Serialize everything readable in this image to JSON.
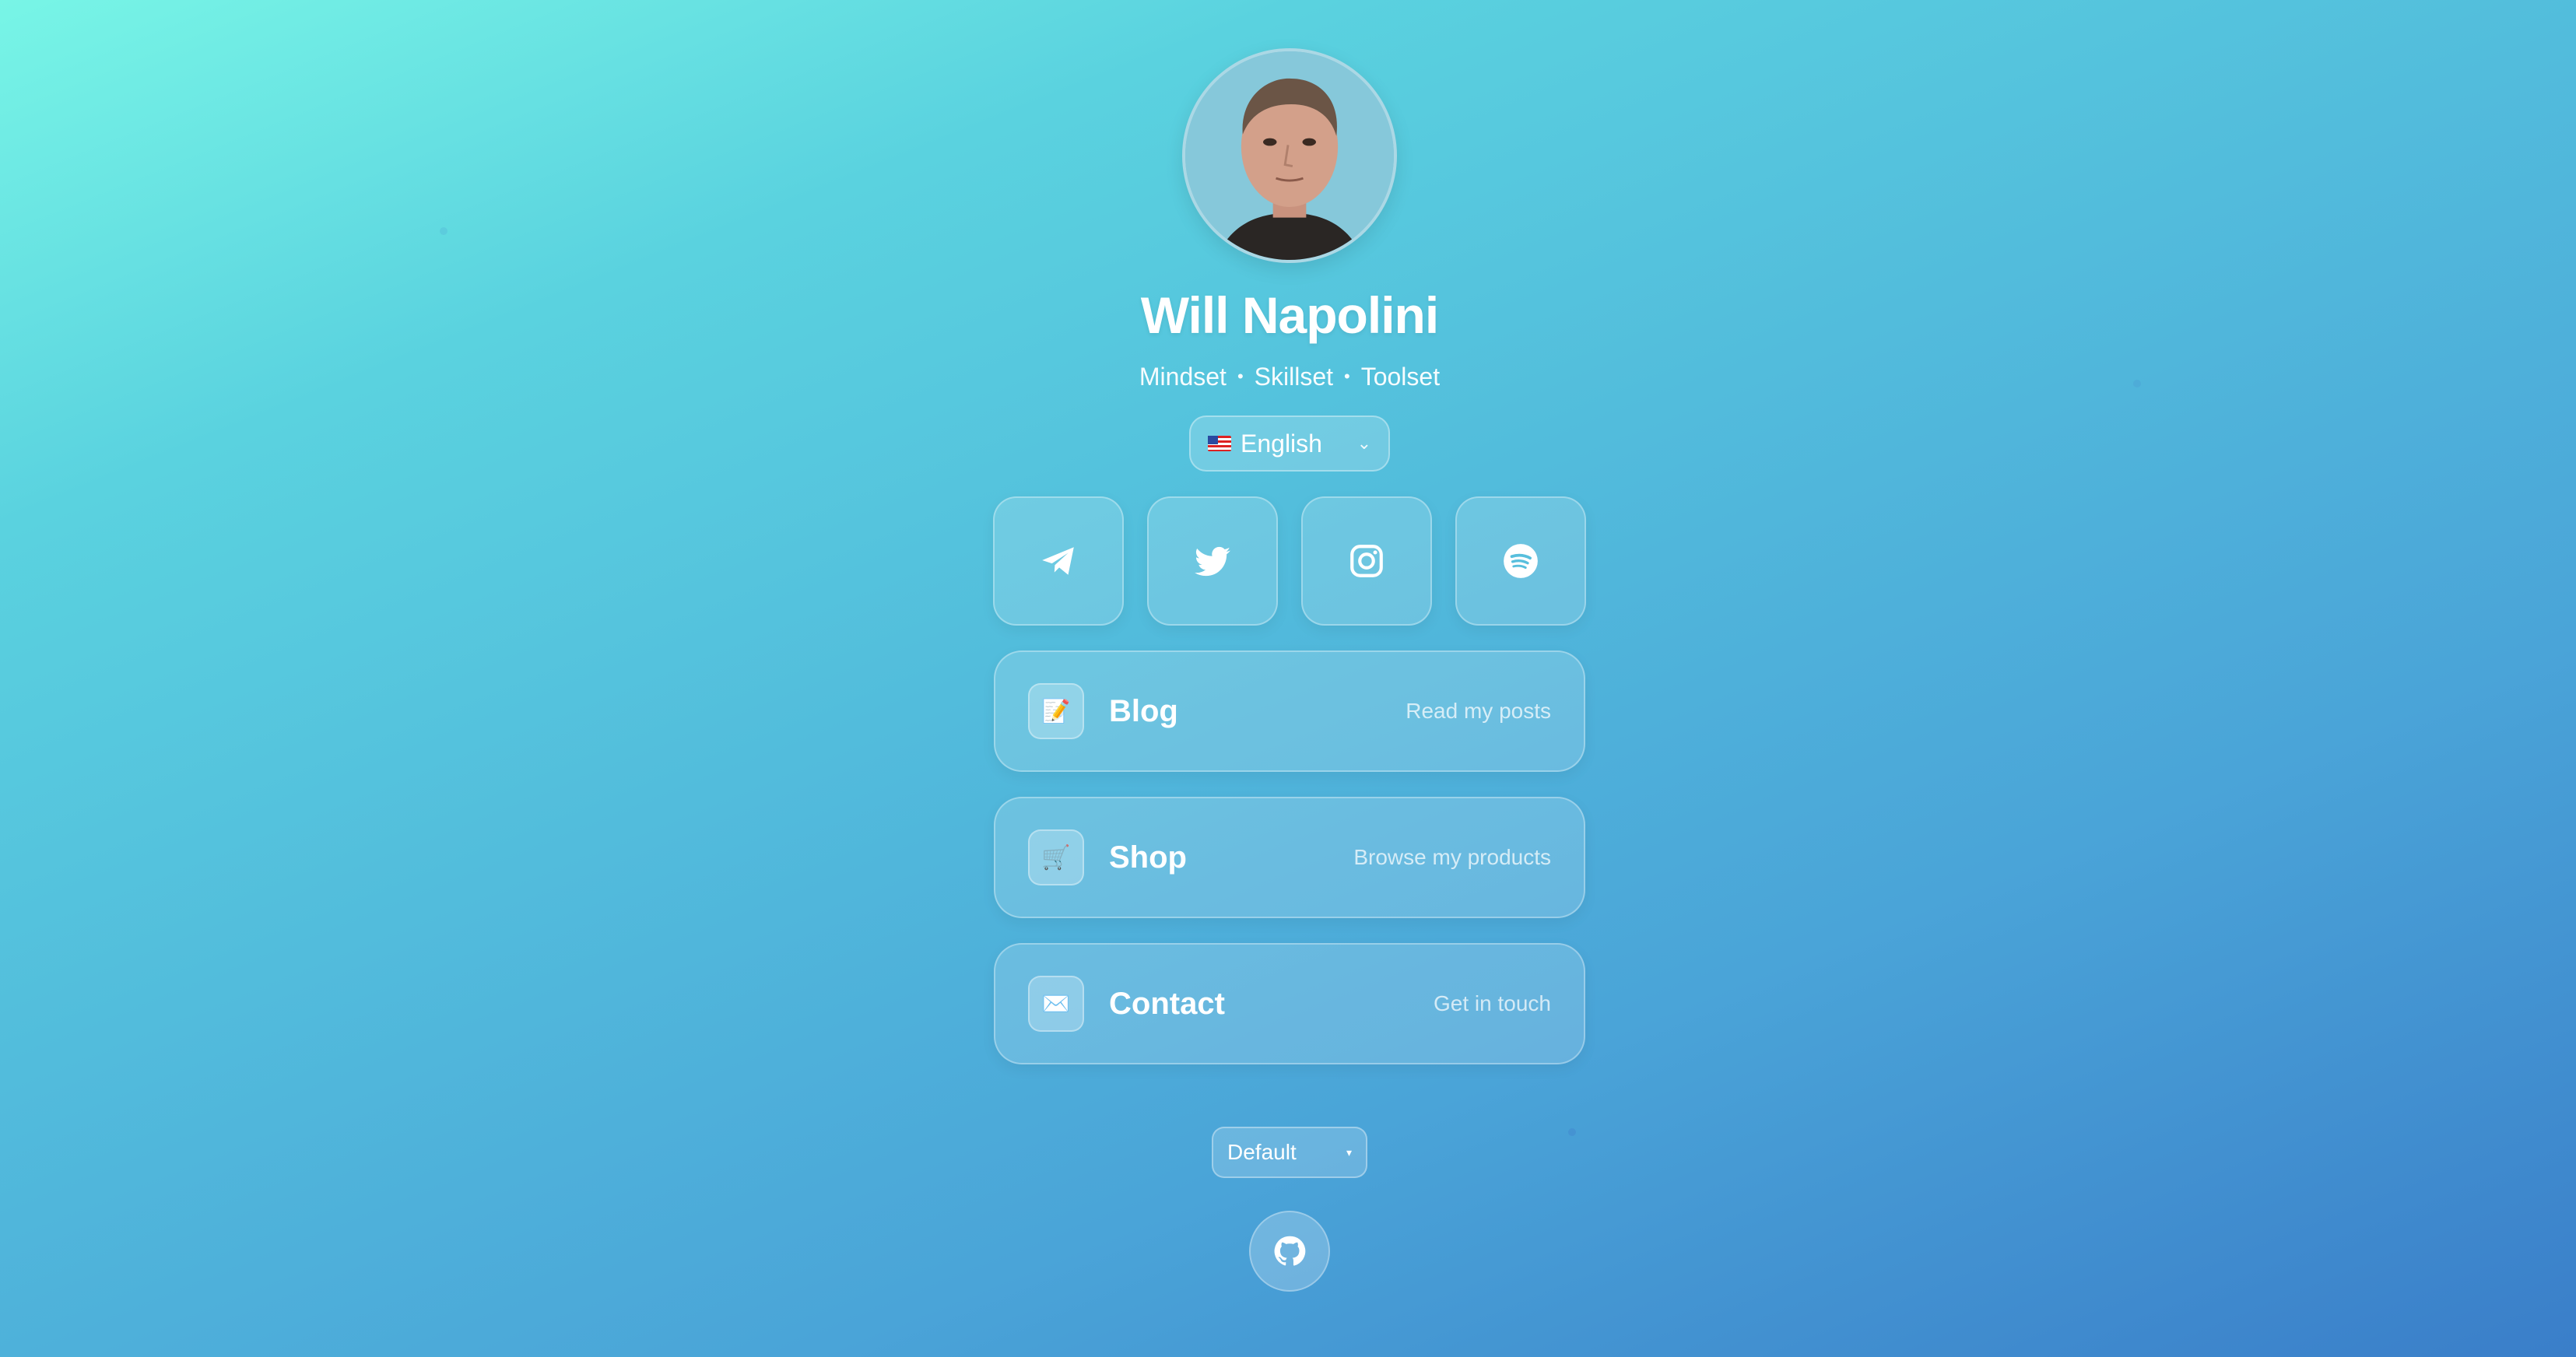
{
  "profile": {
    "name": "Will Napolini",
    "tagline": [
      "Mindset",
      "Skillset",
      "Toolset"
    ],
    "separator": "•"
  },
  "language": {
    "selected": "English",
    "flag": "us-flag",
    "chevron": "⌄"
  },
  "socials": [
    {
      "name": "telegram",
      "icon": "telegram-icon"
    },
    {
      "name": "twitter",
      "icon": "twitter-icon"
    },
    {
      "name": "instagram",
      "icon": "instagram-icon"
    },
    {
      "name": "spotify",
      "icon": "spotify-icon"
    }
  ],
  "links": [
    {
      "title": "Blog",
      "subtitle": "Read my posts",
      "icon": "📝"
    },
    {
      "title": "Shop",
      "subtitle": "Browse my products",
      "icon": "🛒"
    },
    {
      "title": "Contact",
      "subtitle": "Get in touch",
      "icon": "✉️"
    }
  ],
  "theme": {
    "selected": "Default",
    "caret": "▾"
  },
  "footer": {
    "icon": "github-icon"
  },
  "colors": {
    "gradient_start": "#78f5e6",
    "gradient_end": "#3a7ec9",
    "text": "#ffffff"
  }
}
